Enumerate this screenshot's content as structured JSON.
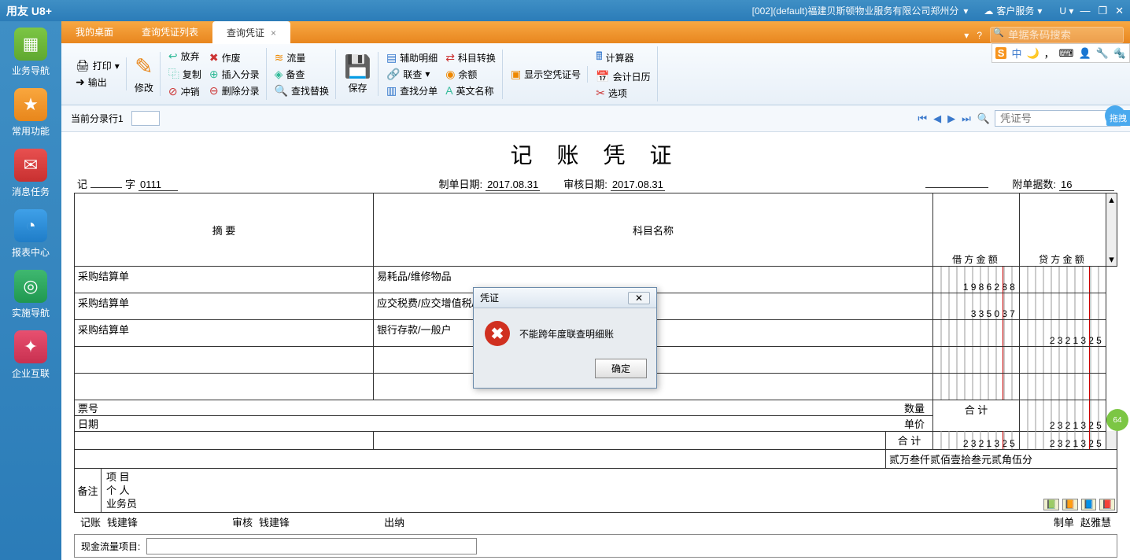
{
  "titlebar": {
    "logo": "用友 U8+",
    "org": "[002](default)福建贝斯顿物业服务有限公司郑州分",
    "customer": "客户服务",
    "u": "U"
  },
  "leftnav": [
    {
      "label": "业务导航"
    },
    {
      "label": "常用功能"
    },
    {
      "label": "消息任务"
    },
    {
      "label": "报表中心"
    },
    {
      "label": "实施导航"
    },
    {
      "label": "企业互联"
    }
  ],
  "tabs": {
    "t1": "我的桌面",
    "t2": "查询凭证列表",
    "t3": "查询凭证"
  },
  "search": {
    "placeholder": "单据条码搜索"
  },
  "ime": {
    "s": "S",
    "zhong": "中"
  },
  "toolbar": {
    "print": "打印",
    "output": "输出",
    "modify": "修改",
    "abandon": "放弃",
    "copy": "复制",
    "writeoff": "冲销",
    "voidx": "作废",
    "insertEntry": "插入分录",
    "delEntry": "删除分录",
    "flow": "流量",
    "bak": "备查",
    "findReplace": "查找替换",
    "save": "保存",
    "auxDetail": "辅助明细",
    "link": "联查",
    "findSplit": "查找分单",
    "subjConv": "科目转换",
    "balance": "余额",
    "engName": "英文名称",
    "showEmpty": "显示空凭证号",
    "calc": "计算器",
    "acctCal": "会计日历",
    "options": "选项"
  },
  "navrow": {
    "label": "当前分录行1",
    "val": "",
    "vchlabel": "凭证号"
  },
  "dragTag": "拖拽",
  "doc": {
    "title": "记 账 凭 证",
    "ji": "记",
    "zi": "字",
    "num": "0111",
    "makedateLbl": "制单日期:",
    "makedate": "2017.08.31",
    "auditdateLbl": "审核日期:",
    "auditdate": "2017.08.31",
    "attachLbl": "附单据数:",
    "attachNum": "16",
    "th_abstract": "摘 要",
    "th_subject": "科目名称",
    "th_debit": "借方金额",
    "th_credit": "贷方金额",
    "rows": [
      {
        "abs": "采购结算单",
        "subj": "易耗品/维修物品",
        "debit": "1986288",
        "credit": ""
      },
      {
        "abs": "采购结算单",
        "subj": "应交税费/应交增值税/待抵扣进项税",
        "debit": "335037",
        "credit": ""
      },
      {
        "abs": "采购结算单",
        "subj": "银行存款/一般户",
        "debit": "",
        "credit": "2321325"
      },
      {
        "abs": "",
        "subj": "",
        "debit": "",
        "credit": ""
      },
      {
        "abs": "",
        "subj": "",
        "debit": "",
        "credit": ""
      }
    ],
    "bill_no_lbl": "票号",
    "bill_date_lbl": "日期",
    "qty_lbl": "数量",
    "price_lbl": "单价",
    "sum_lbl": "合 计",
    "sum_debit": "2321325",
    "sum_credit": "2321325",
    "chn_amount": "贰万叁仟贰佰壹拾叁元贰角伍分",
    "remark_lbl": "备注",
    "remark_proj": "项 目",
    "remark_person": "个 人",
    "remark_sales": "业务员",
    "sign_jz": "记账",
    "sign_jz_v": "钱建锋",
    "sign_sh": "审核",
    "sign_sh_v": "钱建锋",
    "sign_cn": "出纳",
    "sign_zd": "制单",
    "sign_zd_v": "赵雅慧",
    "cashflow_lbl": "现金流量项目:"
  },
  "dialog": {
    "title": "凭证",
    "msg": "不能跨年度联查明细账",
    "ok": "确定"
  },
  "floatBadge": "64"
}
